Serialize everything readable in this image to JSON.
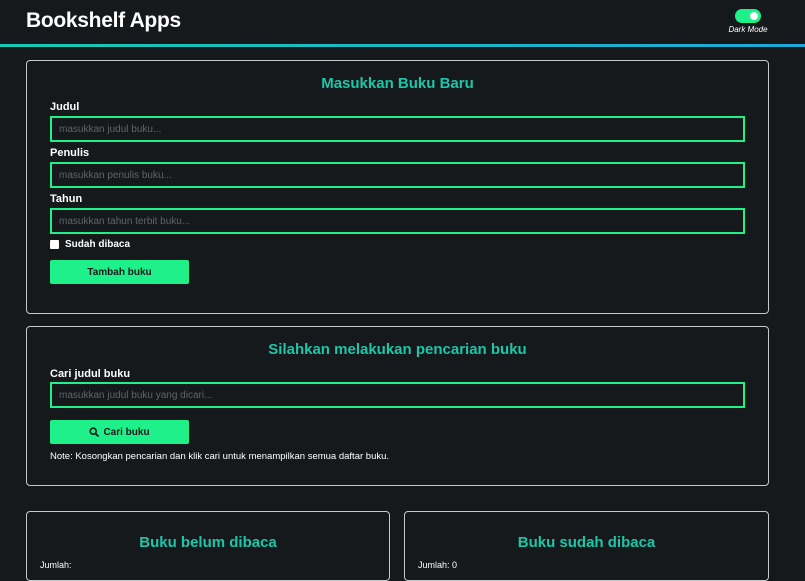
{
  "header": {
    "title": "Bookshelf Apps",
    "dark_mode_label": "Dark Mode",
    "dark_mode_on": true
  },
  "add_form": {
    "title": "Masukkan Buku Baru",
    "title_label": "Judul",
    "title_placeholder": "masukkan judul buku...",
    "author_label": "Penulis",
    "author_placeholder": "masukkan penulis buku...",
    "year_label": "Tahun",
    "year_placeholder": "masukkan tahun terbit buku...",
    "read_checkbox_label": "Sudah dibaca",
    "submit_label": "Tambah buku"
  },
  "search": {
    "title": "Silahkan melakukan pencarian buku",
    "label": "Cari judul buku",
    "placeholder": "masukkan judul buku yang dicari...",
    "button_label": "Cari buku",
    "note": "Note: Kosongkan pencarian dan klik cari untuk menampilkan semua daftar buku."
  },
  "shelves": {
    "unread": {
      "title": "Buku belum dibaca",
      "count_label": "Jumlah: "
    },
    "read": {
      "title": "Buku sudah dibaca",
      "count_label": "Jumlah: 0"
    }
  },
  "colors": {
    "accent": "#1ef08a",
    "heading": "#1cc6a8",
    "background": "#15191c"
  }
}
